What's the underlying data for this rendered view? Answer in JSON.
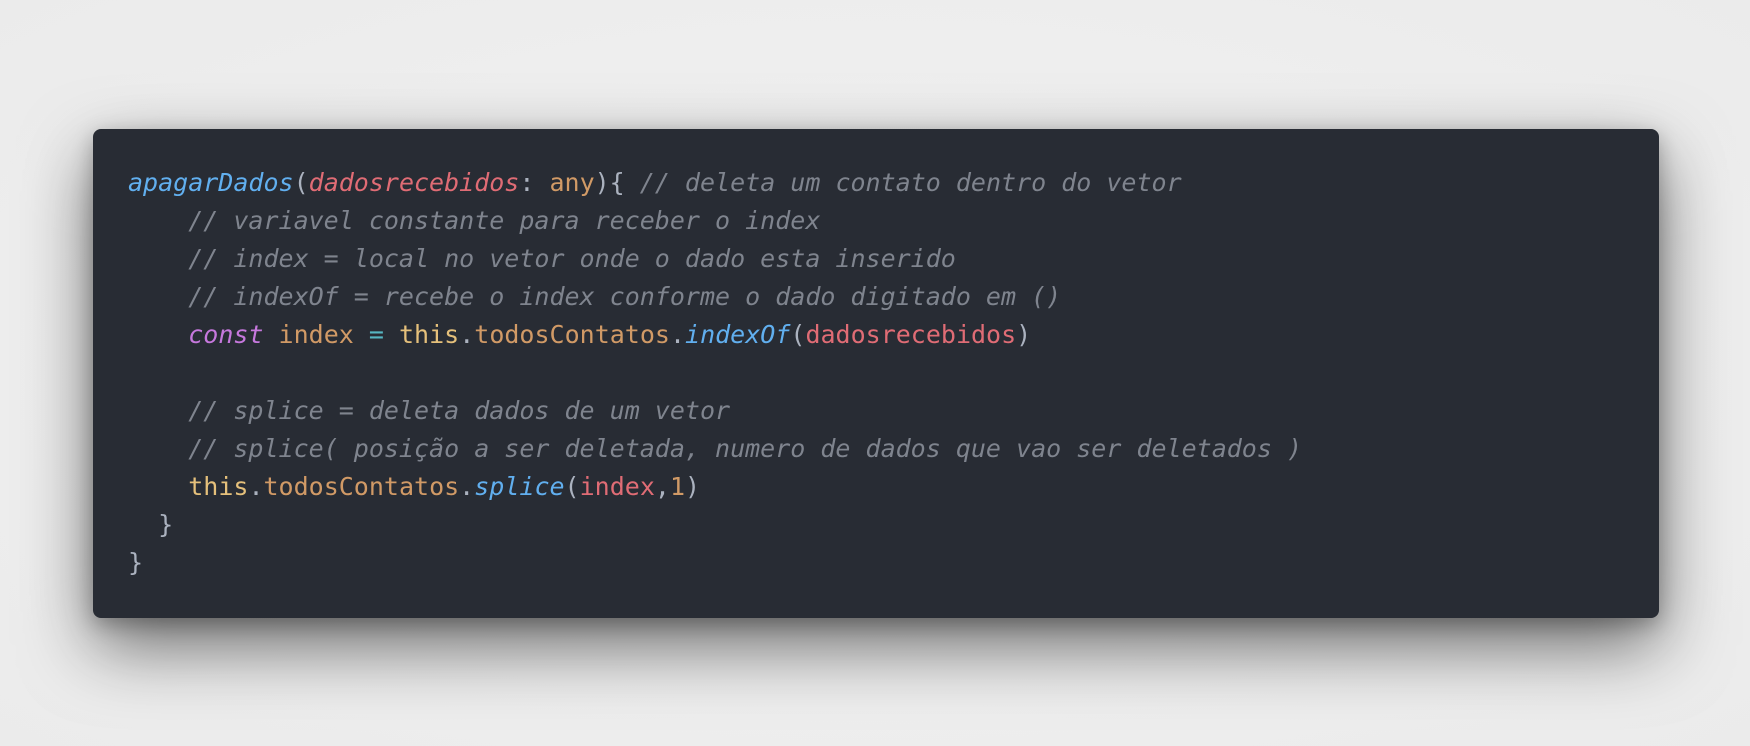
{
  "lines": [
    [
      {
        "t": "apagarDados",
        "c": "fn"
      },
      {
        "t": "(",
        "c": "punct"
      },
      {
        "t": "dadosrecebidos",
        "c": "param"
      },
      {
        "t": ": ",
        "c": "punct"
      },
      {
        "t": "any",
        "c": "type"
      },
      {
        "t": "){ ",
        "c": "punct"
      },
      {
        "t": "// deleta um contato dentro do vetor",
        "c": "comment"
      }
    ],
    [
      {
        "t": "    ",
        "c": "punct"
      },
      {
        "t": "// variavel constante para receber o index",
        "c": "comment"
      }
    ],
    [
      {
        "t": "    ",
        "c": "punct"
      },
      {
        "t": "// index = local no vetor onde o dado esta inserido",
        "c": "comment"
      }
    ],
    [
      {
        "t": "    ",
        "c": "punct"
      },
      {
        "t": "// indexOf = recebe o index conforme o dado digitado em ()",
        "c": "comment"
      }
    ],
    [
      {
        "t": "    ",
        "c": "punct"
      },
      {
        "t": "const",
        "c": "kw"
      },
      {
        "t": " ",
        "c": "punct"
      },
      {
        "t": "index",
        "c": "var"
      },
      {
        "t": " ",
        "c": "punct"
      },
      {
        "t": "=",
        "c": "op"
      },
      {
        "t": " ",
        "c": "punct"
      },
      {
        "t": "this",
        "c": "this"
      },
      {
        "t": ".",
        "c": "punct"
      },
      {
        "t": "todosContatos",
        "c": "prop"
      },
      {
        "t": ".",
        "c": "punct"
      },
      {
        "t": "indexOf",
        "c": "fn"
      },
      {
        "t": "(",
        "c": "punct"
      },
      {
        "t": "dadosrecebidos",
        "c": "arg"
      },
      {
        "t": ")",
        "c": "punct"
      }
    ],
    [],
    [
      {
        "t": "    ",
        "c": "punct"
      },
      {
        "t": "// splice = deleta dados de um vetor",
        "c": "comment"
      }
    ],
    [
      {
        "t": "    ",
        "c": "punct"
      },
      {
        "t": "// splice( posição a ser deletada, numero de dados que vao ser deletados )",
        "c": "comment"
      }
    ],
    [
      {
        "t": "    ",
        "c": "punct"
      },
      {
        "t": "this",
        "c": "this"
      },
      {
        "t": ".",
        "c": "punct"
      },
      {
        "t": "todosContatos",
        "c": "prop"
      },
      {
        "t": ".",
        "c": "punct"
      },
      {
        "t": "splice",
        "c": "fn"
      },
      {
        "t": "(",
        "c": "punct"
      },
      {
        "t": "index",
        "c": "arg"
      },
      {
        "t": ",",
        "c": "punct"
      },
      {
        "t": "1",
        "c": "num"
      },
      {
        "t": ")",
        "c": "punct"
      }
    ],
    [
      {
        "t": "  ",
        "c": "punct"
      },
      {
        "t": "}",
        "c": "punct"
      }
    ],
    [
      {
        "t": "}",
        "c": "punct"
      }
    ]
  ]
}
